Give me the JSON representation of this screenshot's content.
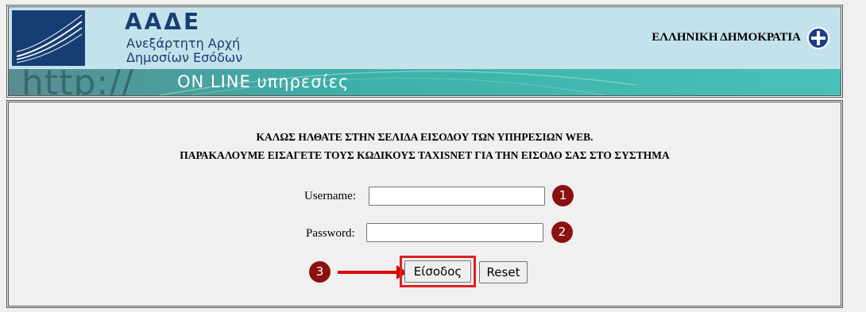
{
  "header": {
    "org_acronym": "ΑΑΔΕ",
    "org_name_line1": "Ανεξάρτητη Αρχή",
    "org_name_line2": "Δημοσίων Εσόδων",
    "republic": "ΕΛΛΗΝΙΚΗ ΔΗΜΟΚΡΑΤΙΑ",
    "banner_http": "http://",
    "banner_online": "ON LINE υπηρεσίες",
    "emblem_icon": "greek-emblem-icon"
  },
  "login": {
    "welcome_line1": "ΚΑΛΩΣ ΗΛΘΑΤΕ ΣΤΗΝ ΣΕΛΙΔΑ ΕΙΣΟΔΟΥ ΤΩΝ ΥΠΗΡΕΣΙΩΝ WEB.",
    "welcome_line2": "ΠΑΡΑΚΑΛΟΥΜΕ ΕΙΣΑΓΕΤΕ ΤΟΥΣ ΚΩΔΙΚΟΥΣ TAXISNET ΓΙΑ ΤΗΝ ΕΙΣΟΔΟ ΣΑΣ ΣΤΟ ΣΥΣΤΗΜΑ",
    "username_label": "Username:",
    "username_value": "",
    "password_label": "Password:",
    "password_value": "",
    "submit_label": "Είσοδος",
    "reset_label": "Reset"
  },
  "annotations": {
    "step1": "1",
    "step2": "2",
    "step3": "3",
    "highlight_color": "#e02020",
    "badge_color": "#8b1010"
  }
}
